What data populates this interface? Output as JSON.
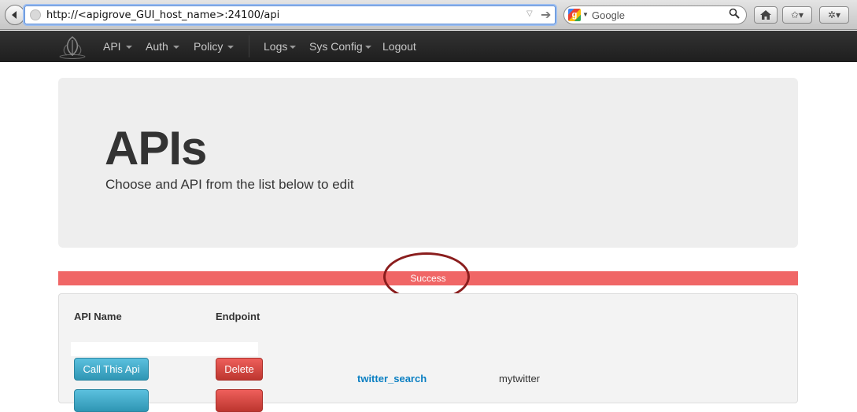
{
  "browser": {
    "url": "http://<apigrove_GUI_host_name>:24100/api",
    "search_placeholder": "Google"
  },
  "navbar": {
    "items": [
      {
        "label": "API",
        "dropdown": true
      },
      {
        "label": "Auth",
        "dropdown": true
      },
      {
        "label": "Policy",
        "dropdown": true
      },
      {
        "label": "Logs",
        "dropdown": true
      },
      {
        "label": "Sys Config",
        "dropdown": true
      },
      {
        "label": "Logout",
        "dropdown": false
      }
    ]
  },
  "hero": {
    "title": "APIs",
    "subtitle": "Choose and API from the list below to edit"
  },
  "alert": {
    "message": "Success",
    "color": "#f06666"
  },
  "table": {
    "headers": [
      "API Name",
      "Endpoint"
    ],
    "rows": [
      {
        "call_label": "Call This Api",
        "delete_label": "Delete",
        "name": "twitter_search",
        "endpoint": "mytwitter"
      }
    ]
  },
  "colors": {
    "navbar": "#222222",
    "link": "#0a7fc2",
    "info_button": "#49afcd",
    "danger_button": "#da4f49"
  }
}
